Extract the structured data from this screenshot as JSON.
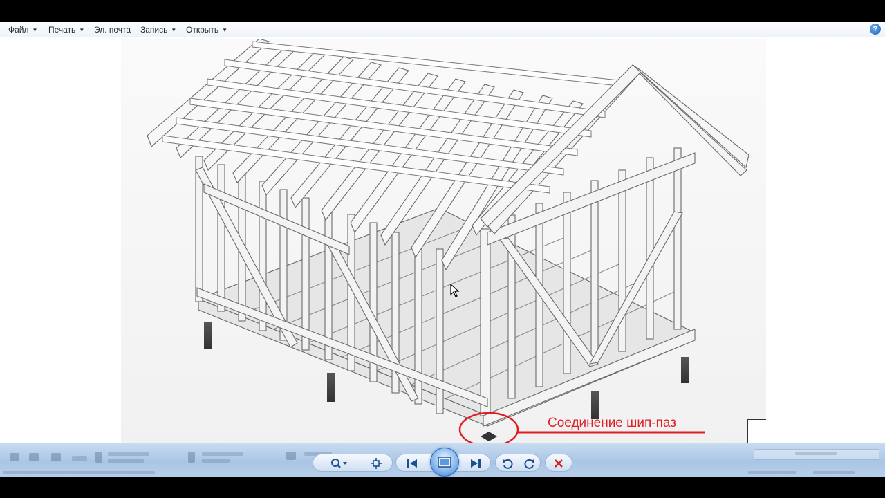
{
  "menu": {
    "file": "Файл",
    "print": "Печать",
    "email": "Эл. почта",
    "burn": "Запись",
    "open": "Открыть"
  },
  "help_icon": "?",
  "image": {
    "subject": "wooden-frame-house-drawing",
    "caption": "Соединение шип-паз",
    "caption_color": "#e11d23"
  },
  "colors": {
    "accent": "#3f7fcf",
    "delete": "#d32020",
    "toolbar_bg": "#b7cfea"
  },
  "controls": [
    {
      "name": "zoom-button",
      "icon": "magnifier-icon"
    },
    {
      "name": "actual-size-button",
      "icon": "fit-icon"
    },
    {
      "name": "previous-button",
      "icon": "previous-icon"
    },
    {
      "name": "slideshow-button",
      "icon": "slideshow-icon"
    },
    {
      "name": "next-button",
      "icon": "next-icon"
    },
    {
      "name": "rotate-left-button",
      "icon": "rotate-ccw-icon"
    },
    {
      "name": "rotate-right-button",
      "icon": "rotate-cw-icon"
    },
    {
      "name": "delete-button",
      "icon": "delete-icon"
    }
  ]
}
